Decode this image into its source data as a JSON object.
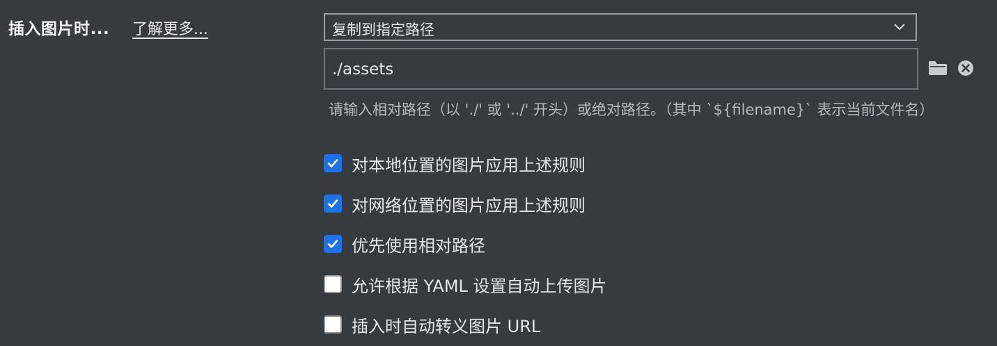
{
  "section": {
    "title": "插入图片时...",
    "learn_more": "了解更多..."
  },
  "action_select": {
    "value": "复制到指定路径"
  },
  "path_field": {
    "value": "./assets"
  },
  "hint": "请输入相对路径（以 './' 或 '../' 开头）或绝对路径。（其中 `${filename}` 表示当前文件名）",
  "options": [
    {
      "label": "对本地位置的图片应用上述规则",
      "checked": true
    },
    {
      "label": "对网络位置的图片应用上述规则",
      "checked": true
    },
    {
      "label": "优先使用相对路径",
      "checked": true
    },
    {
      "label": "允许根据 YAML 设置自动上传图片",
      "checked": false
    },
    {
      "label": "插入时自动转义图片 URL",
      "checked": false
    }
  ],
  "colors": {
    "background": "#363b40",
    "checkbox_accent": "#1a73e8"
  }
}
